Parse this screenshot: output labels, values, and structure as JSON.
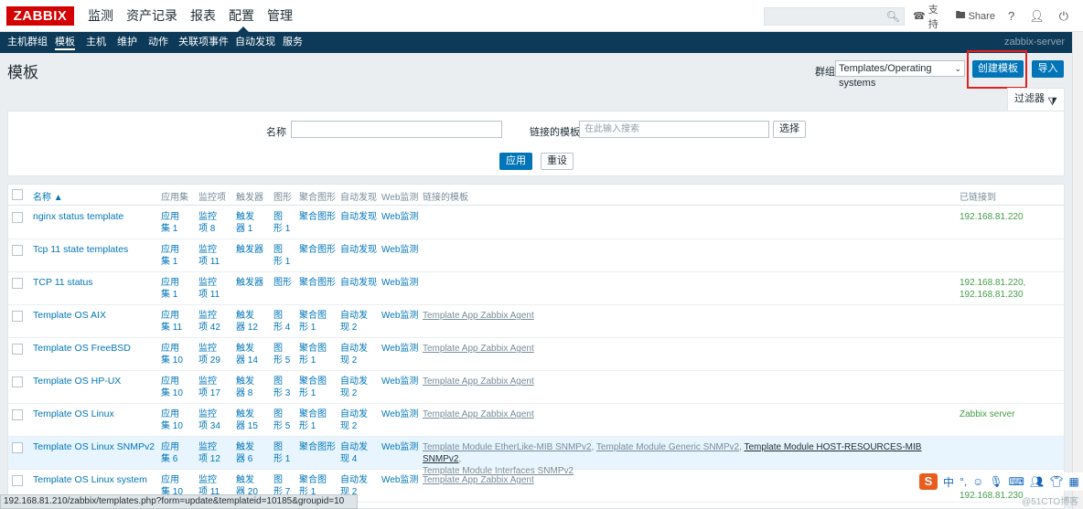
{
  "logo": "ZABBIX",
  "top_menu": [
    "监测",
    "资产记录",
    "报表",
    "配置",
    "管理"
  ],
  "top_links": {
    "support": "支持",
    "share": "Share",
    "help": "?"
  },
  "sub_menu": [
    "主机群组",
    "模板",
    "主机",
    "维护",
    "动作",
    "关联项事件",
    "自动发现",
    "服务"
  ],
  "server_name": "zabbix-server",
  "page_title": "模板",
  "group_label": "群组",
  "group_value": "Templates/Operating systems",
  "create_button": "创建模板",
  "import_button": "导入",
  "filter_tab": "过滤器",
  "filter": {
    "name_label": "名称",
    "name_value": "",
    "linked_label": "链接的模板",
    "linked_placeholder": "在此输入搜索",
    "select_button": "选择",
    "apply_button": "应用",
    "reset_button": "重设"
  },
  "table": {
    "headers": {
      "name": "名称 ▲",
      "applications": "应用集",
      "items": "监控项",
      "triggers": "触发器",
      "graphs": "图形",
      "screens": "聚合图形",
      "discovery": "自动发现",
      "web": "Web监测",
      "linked_templates": "链接的模板",
      "linked_to": "已链接到"
    },
    "rows": [
      {
        "name": "nginx status template",
        "app": [
          "应用",
          "集 1"
        ],
        "items": [
          "监控",
          "项 8"
        ],
        "triggers": [
          "触发",
          "器 1"
        ],
        "graphs": [
          "图",
          "形 1"
        ],
        "screens": [
          "聚合图形",
          ""
        ],
        "discovery": [
          "自动发现",
          ""
        ],
        "web": "Web监测",
        "linked": "",
        "linked_to": [
          "192.168.81.220"
        ]
      },
      {
        "name": "Tcp 11 state templates",
        "app": [
          "应用",
          "集 1"
        ],
        "items": [
          "监控",
          "项 11"
        ],
        "triggers": [
          "触发器",
          ""
        ],
        "graphs": [
          "图",
          "形 1"
        ],
        "screens": [
          "聚合图形",
          ""
        ],
        "discovery": [
          "自动发现",
          ""
        ],
        "web": "Web监测",
        "linked": "",
        "linked_to": []
      },
      {
        "name": "TCP 11 status",
        "app": [
          "应用",
          "集 1"
        ],
        "items": [
          "监控",
          "项 11"
        ],
        "triggers": [
          "触发器",
          ""
        ],
        "graphs": [
          "图形",
          ""
        ],
        "screens": [
          "聚合图形",
          ""
        ],
        "discovery": [
          "自动发现",
          ""
        ],
        "web": "Web监测",
        "linked": "",
        "linked_to": [
          "192.168.81.220,",
          "192.168.81.230"
        ]
      },
      {
        "name": "Template OS AIX",
        "app": [
          "应用",
          "集 11"
        ],
        "items": [
          "监控",
          "项 42"
        ],
        "triggers": [
          "触发",
          "器 12"
        ],
        "graphs": [
          "图",
          "形 4"
        ],
        "screens": [
          "聚合图",
          "形 1"
        ],
        "discovery": [
          "自动发",
          "现 2"
        ],
        "web": "Web监测",
        "linked": "Template App Zabbix Agent",
        "linked_to": []
      },
      {
        "name": "Template OS FreeBSD",
        "app": [
          "应用",
          "集 10"
        ],
        "items": [
          "监控",
          "项 29"
        ],
        "triggers": [
          "触发",
          "器 14"
        ],
        "graphs": [
          "图",
          "形 5"
        ],
        "screens": [
          "聚合图",
          "形 1"
        ],
        "discovery": [
          "自动发",
          "现 2"
        ],
        "web": "Web监测",
        "linked": "Template App Zabbix Agent",
        "linked_to": []
      },
      {
        "name": "Template OS HP-UX",
        "app": [
          "应用",
          "集 10"
        ],
        "items": [
          "监控",
          "项 17"
        ],
        "triggers": [
          "触发",
          "器 8"
        ],
        "graphs": [
          "图",
          "形 3"
        ],
        "screens": [
          "聚合图",
          "形 1"
        ],
        "discovery": [
          "自动发",
          "现 2"
        ],
        "web": "Web监测",
        "linked": "Template App Zabbix Agent",
        "linked_to": []
      },
      {
        "name": "Template OS Linux",
        "app": [
          "应用",
          "集 10"
        ],
        "items": [
          "监控",
          "项 34"
        ],
        "triggers": [
          "触发",
          "器 15"
        ],
        "graphs": [
          "图",
          "形 5"
        ],
        "screens": [
          "聚合图",
          "形 1"
        ],
        "discovery": [
          "自动发",
          "现 2"
        ],
        "web": "Web监测",
        "linked": "Template App Zabbix Agent",
        "linked_to": [
          "Zabbix server"
        ]
      },
      {
        "name": "Template OS Linux SNMPv2",
        "app": [
          "应用",
          "集 6"
        ],
        "items": [
          "监控",
          "项 12"
        ],
        "triggers": [
          "触发",
          "器 6"
        ],
        "graphs": [
          "图",
          "形 1"
        ],
        "screens": [
          "聚合图形",
          ""
        ],
        "discovery": [
          "自动发",
          "现 4"
        ],
        "web": "Web监测",
        "linked_parts": [
          "Template Module EtherLike-MIB SNMPv2",
          ", ",
          "Template Module Generic SNMPv2",
          ", ",
          "Template Module HOST-RESOURCES-MIB SNMPv2",
          ",",
          "Template Module Interfaces SNMPv2"
        ],
        "linked_to": []
      },
      {
        "name": "Template OS Linux system",
        "app": [
          "应用",
          "集 10"
        ],
        "items": [
          "监控",
          "项 11"
        ],
        "triggers": [
          "触发",
          "器 20"
        ],
        "graphs": [
          "图",
          "形 7"
        ],
        "screens": [
          "聚合图",
          "形 1"
        ],
        "discovery": [
          "自动发",
          "现 2"
        ],
        "web": "Web监测",
        "linked": "Template App Zabbix Agent",
        "linked_to": [
          "192.168.81.230"
        ]
      }
    ]
  },
  "status_url": "192.168.81.210/zabbix/templates.php?form=update&templateid=10185&groupid=10",
  "ime": {
    "logo": "S",
    "lang": "中"
  },
  "watermark": "@51CTO博客",
  "colors": {
    "brand": "#d40000",
    "nav": "#0d3a58",
    "primary": "#0275b8",
    "linked_host": "#429e47",
    "highlight_border": "#e02020"
  }
}
